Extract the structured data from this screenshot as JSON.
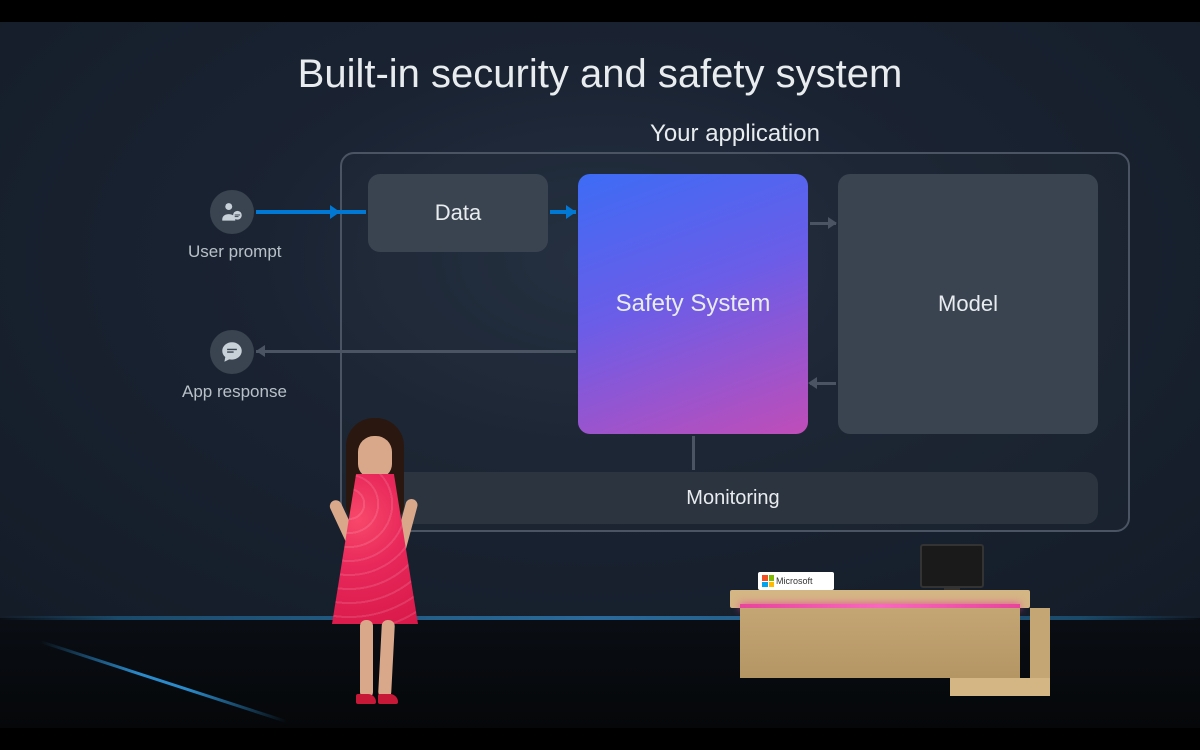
{
  "slide": {
    "title": "Built-in security and safety system",
    "app_frame_label": "Your application",
    "user_prompt_label": "User prompt",
    "app_response_label": "App response",
    "boxes": {
      "data": "Data",
      "safety": "Safety System",
      "model": "Model",
      "monitoring": "Monitoring"
    }
  },
  "stage": {
    "desk_logo_text": "Microsoft"
  },
  "chart_data": {
    "type": "flow-diagram",
    "title": "Built-in security and safety system",
    "container": "Your application",
    "nodes": [
      {
        "id": "user_prompt",
        "label": "User prompt",
        "kind": "external-input",
        "icon": "user-chat"
      },
      {
        "id": "app_response",
        "label": "App response",
        "kind": "external-output",
        "icon": "chat-bubble"
      },
      {
        "id": "data",
        "label": "Data",
        "kind": "box",
        "in_container": true
      },
      {
        "id": "safety",
        "label": "Safety System",
        "kind": "box-highlight",
        "in_container": true
      },
      {
        "id": "model",
        "label": "Model",
        "kind": "box",
        "in_container": true
      },
      {
        "id": "monitoring",
        "label": "Monitoring",
        "kind": "bar",
        "in_container": true
      }
    ],
    "edges": [
      {
        "from": "user_prompt",
        "to": "data",
        "style": "accent"
      },
      {
        "from": "data",
        "to": "safety",
        "style": "accent"
      },
      {
        "from": "safety",
        "to": "model",
        "style": "normal"
      },
      {
        "from": "model",
        "to": "safety",
        "style": "normal"
      },
      {
        "from": "safety",
        "to": "app_response",
        "style": "normal"
      },
      {
        "from": "safety",
        "to": "monitoring",
        "style": "normal"
      }
    ]
  }
}
